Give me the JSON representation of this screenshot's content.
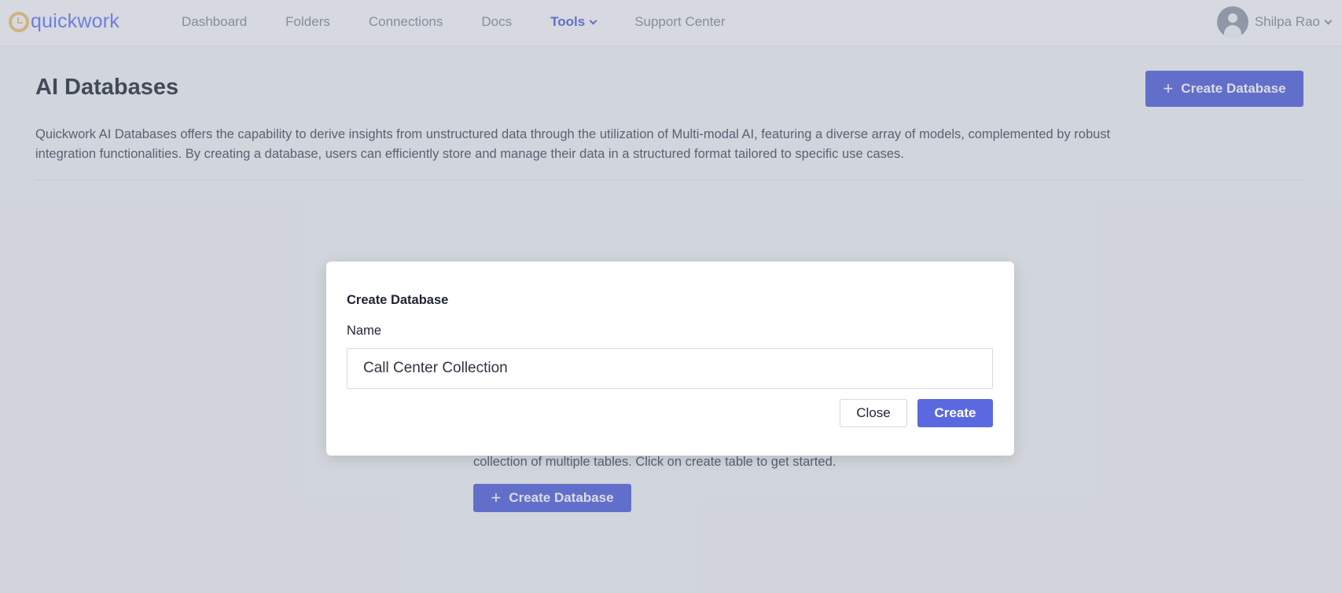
{
  "brand": {
    "name": "quickwork"
  },
  "nav": {
    "items": [
      {
        "label": "Dashboard"
      },
      {
        "label": "Folders"
      },
      {
        "label": "Connections"
      },
      {
        "label": "Docs"
      },
      {
        "label": "Tools",
        "active": true
      },
      {
        "label": "Support Center"
      }
    ]
  },
  "user": {
    "name": "Shilpa Rao"
  },
  "page": {
    "title": "AI Databases",
    "create_button_label": "Create Database",
    "description": "Quickwork AI Databases offers the capability to derive insights from unstructured data through the utilization of Multi-modal AI, featuring a diverse array of models, complemented by robust integration functionalities. By creating a database, users can efficiently store and manage their data in a structured format tailored to specific use cases."
  },
  "empty_state": {
    "text": "collection of multiple tables. Click on create table to get started.",
    "button_label": "Create Database"
  },
  "modal": {
    "title": "Create Database",
    "name_label": "Name",
    "name_value": "Call Center Collection",
    "close_label": "Close",
    "create_label": "Create"
  },
  "colors": {
    "accent": "#5b69e0",
    "logo_mark": "#f2c57c"
  }
}
